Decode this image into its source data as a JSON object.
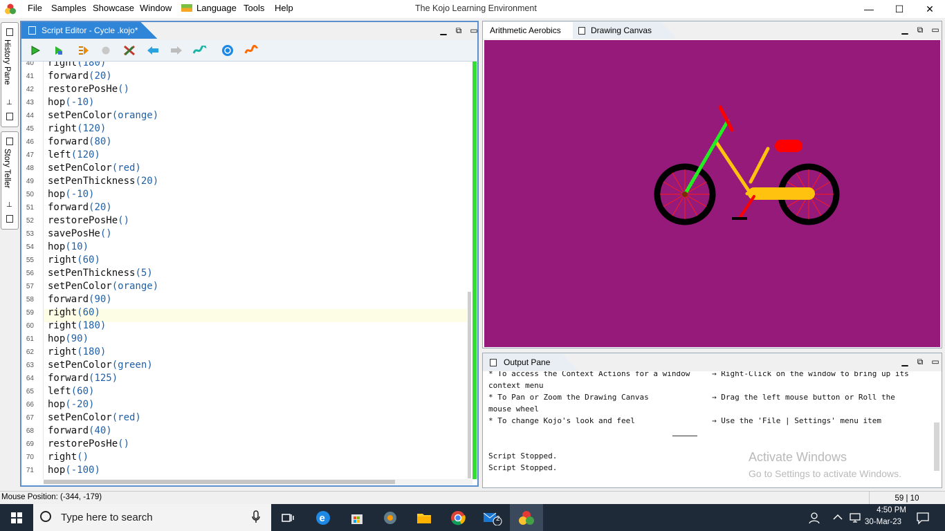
{
  "window": {
    "title": "The Kojo Learning Environment",
    "menu": [
      "File",
      "Samples",
      "Showcase",
      "Window",
      "Language",
      "Tools",
      "Help"
    ],
    "controls": {
      "minimize": "—",
      "maximize": "☐",
      "close": "✕"
    }
  },
  "side_dock": {
    "history_label": "History Pane",
    "story_label": "Story Teller"
  },
  "editor": {
    "tab_title": "Script Editor - Cycle .kojo*",
    "toolbar": [
      {
        "name": "run-button",
        "icon": "play-icon"
      },
      {
        "name": "run-worksheet-button",
        "icon": "step-run-icon"
      },
      {
        "name": "trace-button",
        "icon": "trace-icon"
      },
      {
        "name": "stop-button",
        "icon": "stop-icon"
      },
      {
        "name": "clear-button",
        "icon": "clear-icon"
      },
      {
        "name": "undo-button",
        "icon": "back-arrow-icon"
      },
      {
        "name": "redo-button",
        "icon": "forward-arrow-icon"
      },
      {
        "name": "format-button",
        "icon": "format-icon"
      },
      {
        "name": "upload-button",
        "icon": "upload-icon"
      },
      {
        "name": "sketch-button",
        "icon": "sketch-icon"
      }
    ],
    "lines": [
      {
        "n": "40",
        "fn": "right",
        "arg": "(180)"
      },
      {
        "n": "41",
        "fn": "forward",
        "arg": "(20)"
      },
      {
        "n": "42",
        "fn": "restorePosHe",
        "arg": "()"
      },
      {
        "n": "43",
        "fn": "hop",
        "arg": "(-10)"
      },
      {
        "n": "44",
        "fn": "setPenColor",
        "arg": "(orange)"
      },
      {
        "n": "45",
        "fn": "right",
        "arg": "(120)"
      },
      {
        "n": "46",
        "fn": "forward",
        "arg": "(80)"
      },
      {
        "n": "47",
        "fn": "left",
        "arg": "(120)"
      },
      {
        "n": "48",
        "fn": "setPenColor",
        "arg": "(red)"
      },
      {
        "n": "49",
        "fn": "setPenThickness",
        "arg": "(20)"
      },
      {
        "n": "50",
        "fn": "hop",
        "arg": "(-10)"
      },
      {
        "n": "51",
        "fn": "forward",
        "arg": "(20)"
      },
      {
        "n": "52",
        "fn": "restorePosHe",
        "arg": "()"
      },
      {
        "n": "53",
        "fn": "savePosHe",
        "arg": "()"
      },
      {
        "n": "54",
        "fn": "hop",
        "arg": "(10)"
      },
      {
        "n": "55",
        "fn": "right",
        "arg": "(60)"
      },
      {
        "n": "56",
        "fn": "setPenThickness",
        "arg": "(5)"
      },
      {
        "n": "57",
        "fn": "setPenColor",
        "arg": "(orange)"
      },
      {
        "n": "58",
        "fn": "forward",
        "arg": "(90)"
      },
      {
        "n": "59",
        "fn": "right",
        "arg": "(60)"
      },
      {
        "n": "60",
        "fn": "right",
        "arg": "(180)"
      },
      {
        "n": "61",
        "fn": "hop",
        "arg": "(90)"
      },
      {
        "n": "62",
        "fn": "right",
        "arg": "(180)"
      },
      {
        "n": "63",
        "fn": "setPenColor",
        "arg": "(green)"
      },
      {
        "n": "64",
        "fn": "forward",
        "arg": "(125)"
      },
      {
        "n": "65",
        "fn": "left",
        "arg": "(60)"
      },
      {
        "n": "66",
        "fn": "hop",
        "arg": "(-20)"
      },
      {
        "n": "67",
        "fn": "setPenColor",
        "arg": "(red)"
      },
      {
        "n": "68",
        "fn": "forward",
        "arg": "(40)"
      },
      {
        "n": "69",
        "fn": "restorePosHe",
        "arg": "()"
      },
      {
        "n": "70",
        "fn": "right",
        "arg": "()"
      },
      {
        "n": "71",
        "fn": "hop",
        "arg": "(-100)"
      }
    ],
    "current_line": "59"
  },
  "right_tabs": {
    "tab1": "Arithmetic Aerobics",
    "tab2": "Drawing Canvas"
  },
  "canvas": {
    "background": "#951a7a",
    "drawing": "bicycle",
    "colors": {
      "wheel": "#000000",
      "frame": "#ffc20e",
      "fork": "#22ee22",
      "handle": "#ff0000",
      "spokes": "#ff0000"
    }
  },
  "output": {
    "tab_title": "Output Pane",
    "rows": [
      {
        "left": "* To access the Context Actions for a window",
        "right": "→ Right-Click on the window to bring up its"
      },
      {
        "left": "context menu",
        "right": ""
      },
      {
        "left": "* To Pan or Zoom the Drawing Canvas",
        "right": "→ Drag the left mouse button or Roll the"
      },
      {
        "left": "mouse wheel",
        "right": ""
      },
      {
        "left": "* To change Kojo's look and feel",
        "right": "→ Use the 'File | Settings' menu item"
      }
    ],
    "messages": [
      "Script Stopped.",
      "Script Stopped."
    ],
    "watermark_title": "Activate Windows",
    "watermark_sub": "Go to Settings to activate Windows."
  },
  "status": {
    "mouse_position": "Mouse Position: (-344, -179)",
    "caret": "59 | 10"
  },
  "taskbar": {
    "search_placeholder": "Type here to search",
    "apps": [
      "task-view-icon",
      "edge-icon",
      "store-icon",
      "media-icon",
      "file-explorer-icon",
      "chrome-icon",
      "mail-icon",
      "kojo-icon"
    ],
    "mail_badge": "2",
    "time": "4:50 PM",
    "date": "30-Mar-23"
  }
}
